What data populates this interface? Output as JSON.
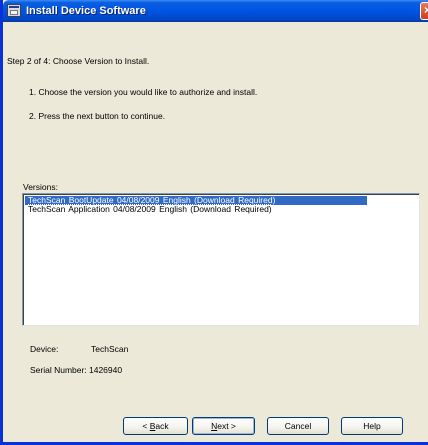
{
  "window": {
    "title": "Install Device Software"
  },
  "content": {
    "step": "Step 2 of 4:  Choose Version to Install.",
    "instruction_1": "1.  Choose the version you would like to authorize and install.",
    "instruction_2": "2.  Press the next button to continue.",
    "versions_label": "Versions:",
    "versions": [
      "TechScan  BootUpdate  04/08/2009  English  (Download Required)",
      "TechScan  Application  04/08/2009  English  (Download Required)"
    ],
    "selected_version_index": 0,
    "device_label": "Device:",
    "device_value": "TechScan",
    "serial_label": "Serial Number:",
    "serial_value": "1426940"
  },
  "buttons": {
    "back_prefix": "< ",
    "back_mnemonic": "B",
    "back_rest": "ack",
    "next_mnemonic": "N",
    "next_rest": "ext >",
    "cancel": "Cancel",
    "help": "Help"
  },
  "colors": {
    "titlebar": "#0054e3",
    "selection": "#316ac5",
    "dialog_face": "#ece9d8"
  }
}
